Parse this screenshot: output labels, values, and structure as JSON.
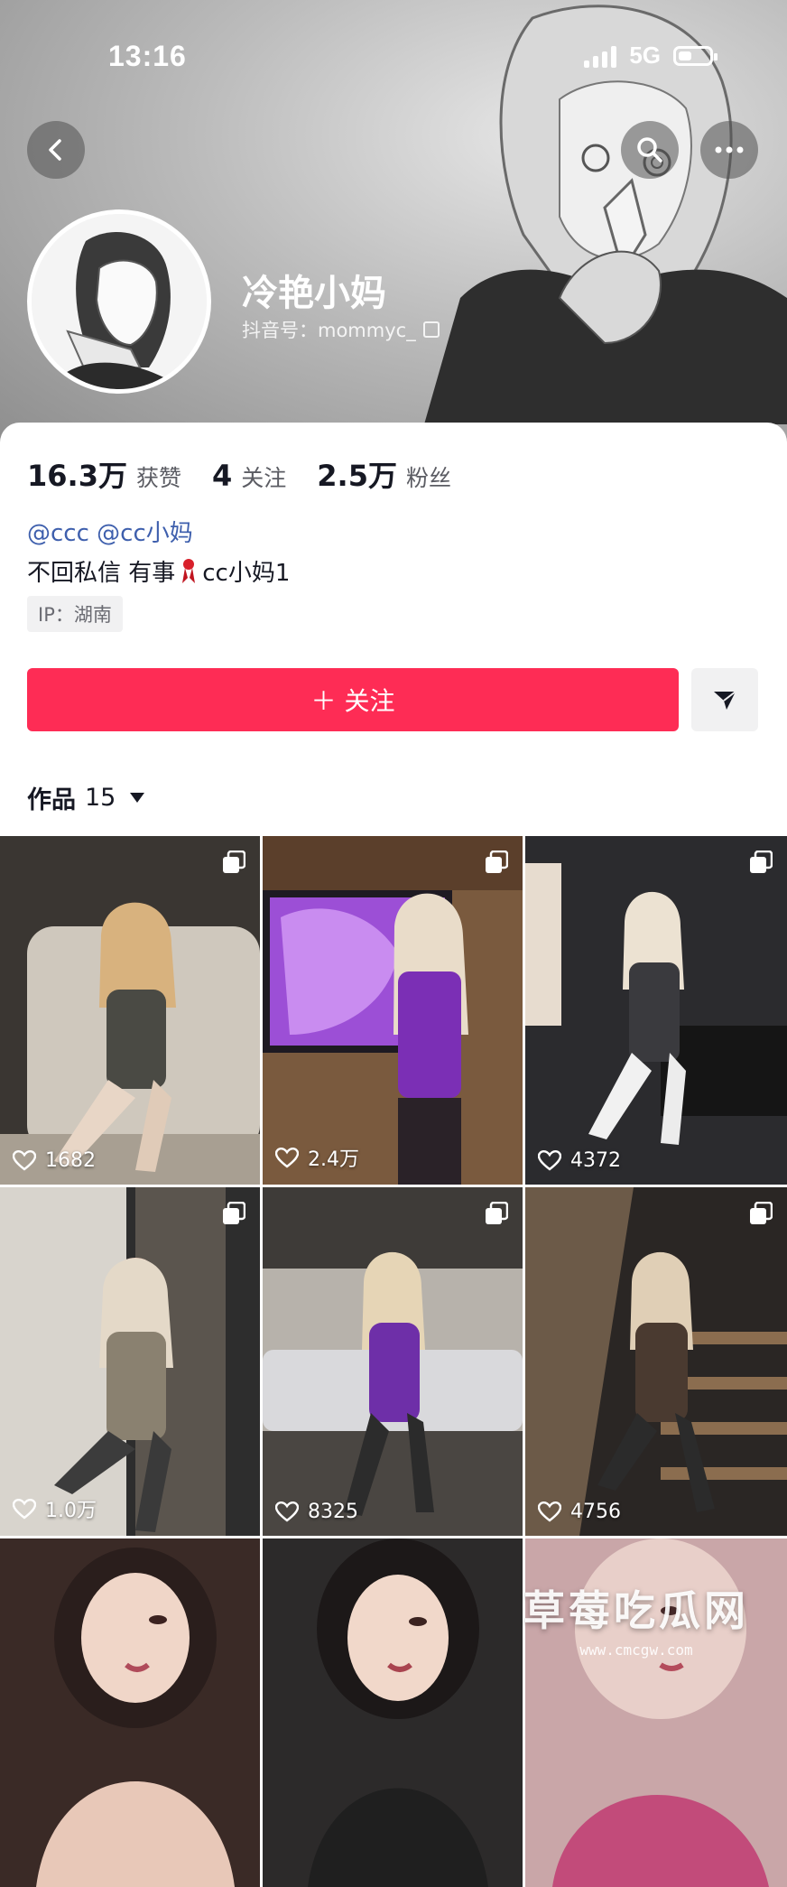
{
  "status_bar": {
    "time": "13:16",
    "network": "5G"
  },
  "profile": {
    "nickname": "冷艳小妈",
    "douyin_id": "抖音号：mommyc_",
    "stats": [
      {
        "value": "16.3万",
        "label": "获赞"
      },
      {
        "value": "4",
        "label": "关注"
      },
      {
        "value": "2.5万",
        "label": "粉丝"
      }
    ],
    "mentions": "@ccc @cc小妈",
    "bio_before": "不回私信 有事",
    "bio_after": "cc小妈1",
    "ip_location": "IP：湖南",
    "follow_label": "＋ 关注",
    "works_label": "作品",
    "works_count": "15"
  },
  "icons": [
    "back-arrow-icon",
    "search-icon",
    "more-icon",
    "share-arrow-icon",
    "copy-icon",
    "heart-icon",
    "multi-image-icon",
    "ribbon-icon"
  ],
  "colors": {
    "accent": "#fe2c55",
    "mention": "#3e5fad"
  },
  "videos": [
    {
      "likes": "1682",
      "multi": true
    },
    {
      "likes": "2.4万",
      "multi": true
    },
    {
      "likes": "4372",
      "multi": true
    },
    {
      "likes": "1.0万",
      "multi": true
    },
    {
      "likes": "8325",
      "multi": true
    },
    {
      "likes": "4756",
      "multi": true
    },
    {
      "likes": "",
      "multi": false
    },
    {
      "likes": "",
      "multi": false
    },
    {
      "likes": "",
      "multi": false
    }
  ],
  "watermark": {
    "title": "草莓吃瓜网",
    "url": "www.cmcgw.com"
  }
}
